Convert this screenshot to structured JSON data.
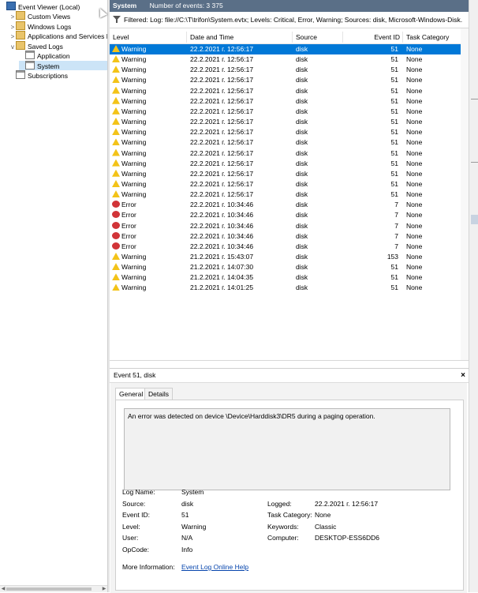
{
  "tree": {
    "items": [
      {
        "label": "Event Viewer (Local)",
        "expander": "",
        "icon": "event-viewer-icon",
        "indent": 0
      },
      {
        "label": "Custom Views",
        "expander": ">",
        "icon": "folder-icon",
        "indent": 1
      },
      {
        "label": "Windows Logs",
        "expander": ">",
        "icon": "folder-icon",
        "indent": 1
      },
      {
        "label": "Applications and Services Lo",
        "expander": ">",
        "icon": "folder-icon",
        "indent": 1
      },
      {
        "label": "Saved Logs",
        "expander": "v",
        "icon": "folder-icon",
        "indent": 1
      },
      {
        "label": "Application",
        "expander": "",
        "icon": "log-icon",
        "indent": 2
      },
      {
        "label": "System",
        "expander": "",
        "icon": "log-icon",
        "indent": 2,
        "selected": true
      },
      {
        "label": "Subscriptions",
        "expander": "",
        "icon": "subscriptions-icon",
        "indent": 1
      }
    ]
  },
  "header": {
    "title": "System",
    "count_label": "Number of events: 3 375"
  },
  "filter": {
    "text": "Filtered: Log: file://C:\\T\\trifon\\System.evtx; Levels: Critical, Error, Warning; Sources: disk, Microsoft-Windows-Disk."
  },
  "grid": {
    "columns": [
      "Level",
      "Date and Time",
      "Source",
      "Event ID",
      "Task Category"
    ],
    "rows": [
      {
        "level": "Warning",
        "date": "22.2.2021 г. 12:56:17",
        "source": "disk",
        "id": "51",
        "task": "None",
        "selected": true
      },
      {
        "level": "Warning",
        "date": "22.2.2021 г. 12:56:17",
        "source": "disk",
        "id": "51",
        "task": "None"
      },
      {
        "level": "Warning",
        "date": "22.2.2021 г. 12:56:17",
        "source": "disk",
        "id": "51",
        "task": "None"
      },
      {
        "level": "Warning",
        "date": "22.2.2021 г. 12:56:17",
        "source": "disk",
        "id": "51",
        "task": "None"
      },
      {
        "level": "Warning",
        "date": "22.2.2021 г. 12:56:17",
        "source": "disk",
        "id": "51",
        "task": "None"
      },
      {
        "level": "Warning",
        "date": "22.2.2021 г. 12:56:17",
        "source": "disk",
        "id": "51",
        "task": "None"
      },
      {
        "level": "Warning",
        "date": "22.2.2021 г. 12:56:17",
        "source": "disk",
        "id": "51",
        "task": "None"
      },
      {
        "level": "Warning",
        "date": "22.2.2021 г. 12:56:17",
        "source": "disk",
        "id": "51",
        "task": "None"
      },
      {
        "level": "Warning",
        "date": "22.2.2021 г. 12:56:17",
        "source": "disk",
        "id": "51",
        "task": "None"
      },
      {
        "level": "Warning",
        "date": "22.2.2021 г. 12:56:17",
        "source": "disk",
        "id": "51",
        "task": "None"
      },
      {
        "level": "Warning",
        "date": "22.2.2021 г. 12:56:17",
        "source": "disk",
        "id": "51",
        "task": "None"
      },
      {
        "level": "Warning",
        "date": "22.2.2021 г. 12:56:17",
        "source": "disk",
        "id": "51",
        "task": "None"
      },
      {
        "level": "Warning",
        "date": "22.2.2021 г. 12:56:17",
        "source": "disk",
        "id": "51",
        "task": "None"
      },
      {
        "level": "Warning",
        "date": "22.2.2021 г. 12:56:17",
        "source": "disk",
        "id": "51",
        "task": "None"
      },
      {
        "level": "Warning",
        "date": "22.2.2021 г. 12:56:17",
        "source": "disk",
        "id": "51",
        "task": "None"
      },
      {
        "level": "Error",
        "date": "22.2.2021 г. 10:34:46",
        "source": "disk",
        "id": "7",
        "task": "None"
      },
      {
        "level": "Error",
        "date": "22.2.2021 г. 10:34:46",
        "source": "disk",
        "id": "7",
        "task": "None"
      },
      {
        "level": "Error",
        "date": "22.2.2021 г. 10:34:46",
        "source": "disk",
        "id": "7",
        "task": "None"
      },
      {
        "level": "Error",
        "date": "22.2.2021 г. 10:34:46",
        "source": "disk",
        "id": "7",
        "task": "None"
      },
      {
        "level": "Error",
        "date": "22.2.2021 г. 10:34:46",
        "source": "disk",
        "id": "7",
        "task": "None"
      },
      {
        "level": "Warning",
        "date": "21.2.2021 г. 15:43:07",
        "source": "disk",
        "id": "153",
        "task": "None"
      },
      {
        "level": "Warning",
        "date": "21.2.2021 г. 14:07:30",
        "source": "disk",
        "id": "51",
        "task": "None"
      },
      {
        "level": "Warning",
        "date": "21.2.2021 г. 14:04:35",
        "source": "disk",
        "id": "51",
        "task": "None"
      },
      {
        "level": "Warning",
        "date": "21.2.2021 г. 14:01:25",
        "source": "disk",
        "id": "51",
        "task": "None"
      }
    ]
  },
  "details": {
    "title": "Event 51, disk",
    "close": "×",
    "tabs": [
      "General",
      "Details"
    ],
    "message": "An error was detected on device \\Device\\Harddisk3\\DR5 during a paging operation.",
    "props_left": [
      {
        "label": "Log Name:",
        "value": "System"
      },
      {
        "label": "Source:",
        "value": "disk"
      },
      {
        "label": "Event ID:",
        "value": "51"
      },
      {
        "label": "Level:",
        "value": "Warning"
      },
      {
        "label": "User:",
        "value": "N/A"
      },
      {
        "label": "OpCode:",
        "value": "Info"
      }
    ],
    "props_right": [
      {
        "label": "Logged:",
        "value": "22.2.2021 г. 12:56:17"
      },
      {
        "label": "Task Category:",
        "value": "None"
      },
      {
        "label": "Keywords:",
        "value": "Classic"
      },
      {
        "label": "Computer:",
        "value": "DESKTOP-ESS6DD6"
      }
    ],
    "more_info_label": "More Information:",
    "more_info_link": "Event Log Online Help"
  },
  "colors": {
    "header_bg": "#5a6f87",
    "selection": "#0078d7",
    "warning": "#f3c318",
    "error": "#d13438"
  }
}
